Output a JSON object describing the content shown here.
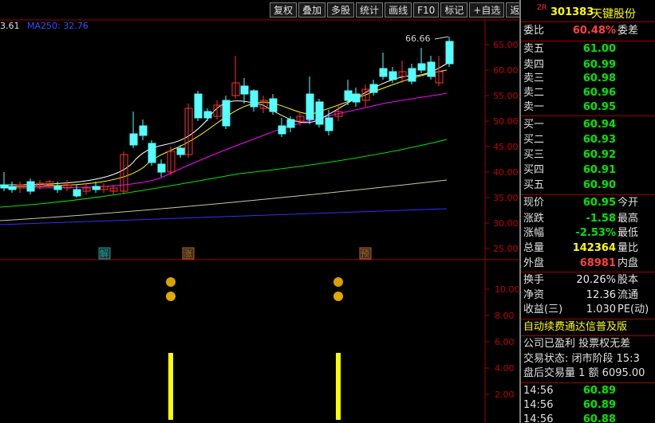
{
  "toolbar": {
    "buttons": [
      "复权",
      "叠加",
      "多股",
      "统计",
      "画线",
      "F10",
      "标记",
      "+自选",
      "返回"
    ]
  },
  "ma_legend": {
    "prev_value": "3.61",
    "ma250_label": "MA250: 32.76"
  },
  "price_chart": {
    "y_ticks": [
      "65.00",
      "60.00",
      "55.00",
      "50.00",
      "45.00",
      "40.00",
      "35.00",
      "30.00",
      "25.00"
    ],
    "high_annotation": "66.66",
    "markers": [
      {
        "text": "解",
        "color": "#00a0a0"
      },
      {
        "text": "涨",
        "color": "#c06000"
      },
      {
        "text": "预",
        "color": "#c06000"
      }
    ]
  },
  "indicator": {
    "y_ticks": [
      "10.00",
      "8.00",
      "6.00",
      "4.00",
      "2.00"
    ]
  },
  "colors": {
    "up": "#ff3232",
    "down": "#54ffff",
    "ma5": "#ffffff",
    "ma10": "#ffff00",
    "ma20": "#ff00ff",
    "ma60": "#00e600",
    "ma120": "#c8c8a0",
    "ma250": "#3030ff"
  },
  "stock": {
    "market_tag": "ZR",
    "code": "301383",
    "name": "天键股份"
  },
  "weibi": {
    "label": "委比",
    "value": "60.48%",
    "label2": "委差"
  },
  "sell_orders": [
    {
      "label": "卖五",
      "price": "61.00"
    },
    {
      "label": "卖四",
      "price": "60.99"
    },
    {
      "label": "卖三",
      "price": "60.98"
    },
    {
      "label": "卖二",
      "price": "60.96"
    },
    {
      "label": "卖一",
      "price": "60.95"
    }
  ],
  "buy_orders": [
    {
      "label": "买一",
      "price": "60.94"
    },
    {
      "label": "买二",
      "price": "60.93"
    },
    {
      "label": "买三",
      "price": "60.92"
    },
    {
      "label": "买四",
      "price": "60.91"
    },
    {
      "label": "买五",
      "price": "60.90"
    }
  ],
  "quote": {
    "now_label": "现价",
    "now": "60.95",
    "open_label": "今开",
    "chg_label": "涨跌",
    "chg": "-1.58",
    "high_label": "最高",
    "pct_label": "涨幅",
    "pct": "-2.53%",
    "low_label": "最低",
    "vol_label": "总量",
    "vol": "142364",
    "vr_label": "量比",
    "outer_label": "外盘",
    "outer": "68981",
    "inner_label": "内盘"
  },
  "finance": {
    "turnover_label": "换手",
    "turnover": "20.26%",
    "equity_label": "股本",
    "nav_label": "净资",
    "nav": "12.36",
    "float_label": "流通",
    "eps_label": "收益(三)",
    "eps": "1.030",
    "pe_label": "PE(动)"
  },
  "notices": {
    "ad": "自动续费通达信普及版",
    "company": "公司已盈利 投票权无差",
    "trade_status": "交易状态: 闭市阶段 15:3",
    "after_hours": "盘后交易量 1 额 6095.00"
  },
  "ticks": [
    {
      "time": "14:56",
      "price": "60.89"
    },
    {
      "time": "14:56",
      "price": "60.89"
    },
    {
      "time": "14:56",
      "price": "60.88"
    }
  ]
}
